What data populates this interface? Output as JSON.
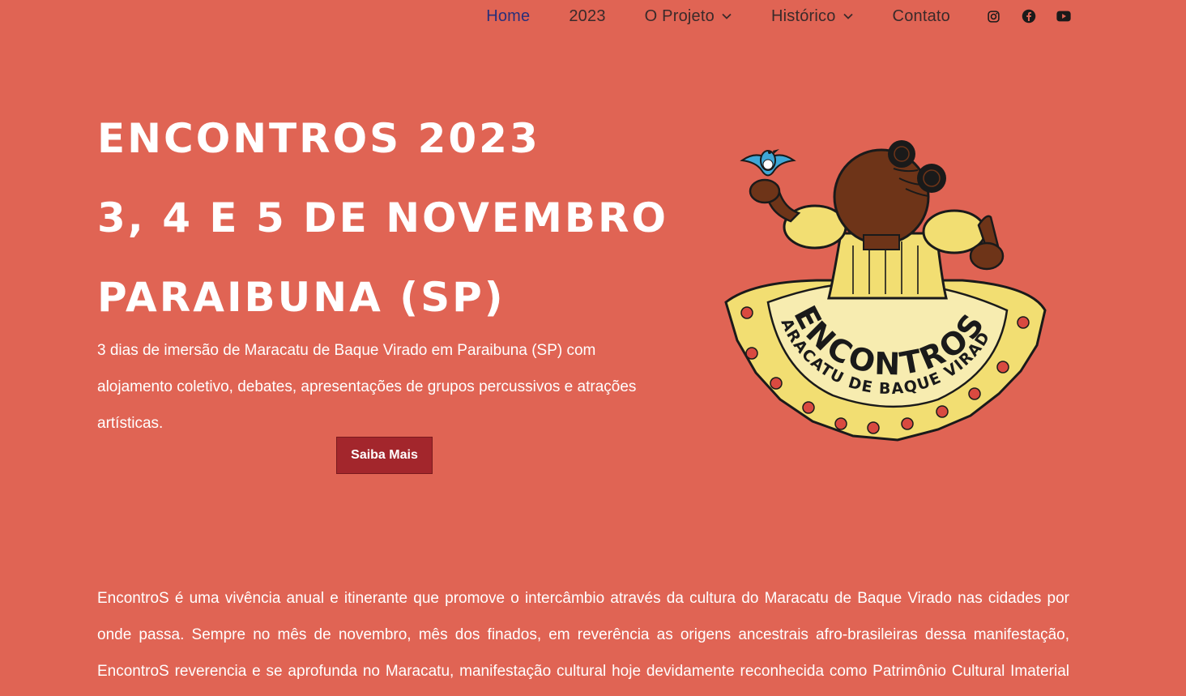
{
  "nav": {
    "items": [
      {
        "label": "Home",
        "active": true,
        "dropdown": false
      },
      {
        "label": "2023",
        "active": false,
        "dropdown": false
      },
      {
        "label": "O Projeto",
        "active": false,
        "dropdown": true
      },
      {
        "label": "Histórico",
        "active": false,
        "dropdown": true
      },
      {
        "label": "Contato",
        "active": false,
        "dropdown": false
      }
    ],
    "social": [
      "instagram-icon",
      "facebook-icon",
      "youtube-icon"
    ]
  },
  "hero": {
    "title_line1": "ENCONTROS 2023",
    "title_line2": "3, 4 E 5 DE NOVEMBRO",
    "title_line3": "PARAIBUNA (SP)",
    "description": "3 dias de imersão de Maracatu de Baque Virado em Paraibuna (SP) com alojamento coletivo, debates, apresentações de grupos percussivos e atrações artísticas.",
    "cta_label": "Saiba Mais"
  },
  "logo": {
    "word1": "ENCONTROS",
    "word2": "MARACATU DE BAQUE VIRADO"
  },
  "about": {
    "text": "EncontroS é uma vivência anual e itinerante que promove o intercâmbio através da cultura do Maracatu de Baque Virado nas cidades por onde passa. Sempre no mês de novembro, mês dos finados, em reverência as origens ancestrais afro-brasileiras dessa manifestação, EncontroS reverencia e se aprofunda no Maracatu, manifestação cultural hoje devidamente reconhecida como Patrimônio Cultural Imaterial Brasileiro."
  },
  "colors": {
    "background": "#e06454",
    "button": "#a3262c",
    "nav_active": "#2a2f7a",
    "nav_text": "#3a2a2a",
    "logo_yellow": "#f4e07a"
  }
}
